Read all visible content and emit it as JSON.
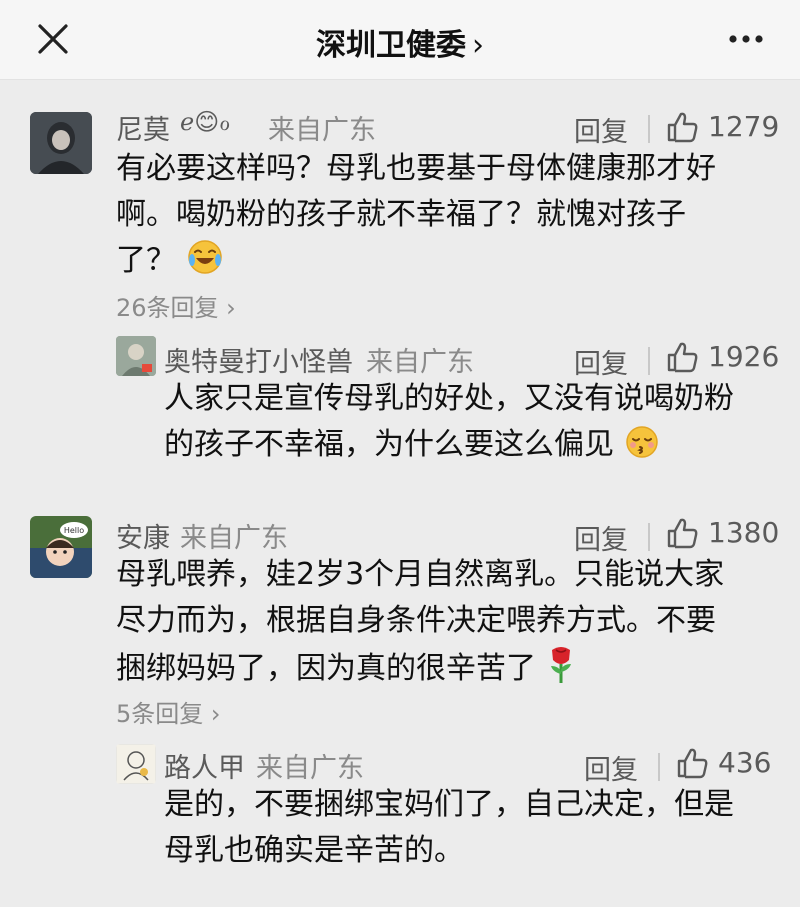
{
  "header": {
    "title": "深圳卫健委",
    "title_chevron": "›",
    "close_icon": "close-icon",
    "more_icon": "more-dots-icon"
  },
  "comments": [
    {
      "name": "尼莫",
      "name_suffix": "ℯ😊ℴ",
      "location": "来自广东",
      "reply_label": "回复",
      "likes": "1279",
      "lines": [
        "有必要这样吗？母乳也要基于母体健康那才好",
        "啊。喝奶粉的孩子就不幸福了？就愧对孩子",
        "了？"
      ],
      "emoji": "laughing-crying-emoji",
      "more_replies": "26条回复",
      "reply": {
        "name": "奥特曼打小怪兽",
        "location": "来自广东",
        "reply_label": "回复",
        "likes": "1926",
        "lines": [
          "人家只是宣传母乳的好处，又没有说喝奶粉",
          "的孩子不幸福，为什么要这么偏见"
        ],
        "emoji": "kissing-face-emoji"
      }
    },
    {
      "name": "安康",
      "location": "来自广东",
      "reply_label": "回复",
      "likes": "1380",
      "avatar_badge": "Hello",
      "lines": [
        "母乳喂养，娃2岁3个月自然离乳。只能说大家",
        "尽力而为，根据自身条件决定喂养方式。不要",
        "捆绑妈妈了，因为真的很辛苦了"
      ],
      "emoji": "rose-emoji",
      "more_replies": "5条回复",
      "reply": {
        "name": "路人甲",
        "location": "来自广东",
        "reply_label": "回复",
        "likes": "436",
        "lines": [
          "是的，不要捆绑宝妈们了，自己决定，但是",
          "母乳也确实是辛苦的。"
        ]
      }
    }
  ],
  "colors": {
    "background": "#ececec",
    "header": "#f6f6f6",
    "name": "#5a5a5a",
    "meta": "#8a8a8a",
    "text": "#111111"
  }
}
